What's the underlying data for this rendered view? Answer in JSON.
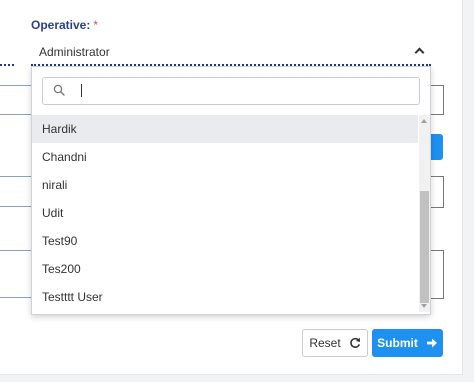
{
  "field": {
    "label": "Operative:",
    "required_mark": "*",
    "selected_value": "Administrator"
  },
  "search": {
    "value": "",
    "placeholder": ""
  },
  "dropdown": {
    "options": [
      "Hardik",
      "Chandni",
      "nirali",
      "Udit",
      "Test90",
      "Tes200",
      "Testttt User"
    ],
    "highlighted_index": 0
  },
  "buttons": {
    "reset_label": "Reset",
    "submit_label": "Submit"
  },
  "colors": {
    "accent": "#1e90f0",
    "label": "#2b3f8c",
    "required": "#e2474b"
  },
  "icons": {
    "select_toggle": "chevron-up-icon",
    "search": "search-icon",
    "reset": "refresh-icon",
    "submit": "arrow-right-icon"
  }
}
